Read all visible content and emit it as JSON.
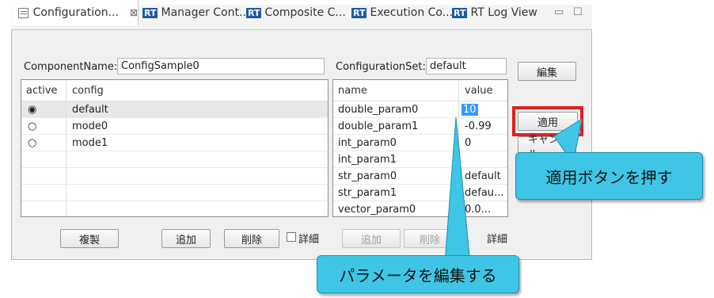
{
  "tabs": [
    {
      "label": "Configuration...",
      "active": true,
      "icon": "config-view-icon"
    },
    {
      "label": "Manager Cont...",
      "rt": "RT"
    },
    {
      "label": "Composite C...",
      "rt": "RT"
    },
    {
      "label": "Execution Co...",
      "rt": "RT"
    },
    {
      "label": "RT Log View",
      "rt": "RT"
    }
  ],
  "tab_close_glyph": "⊠",
  "window_controls": {
    "minimize": "▭",
    "maximize": "☐"
  },
  "component": {
    "label": "ComponentName:",
    "value": "ConfigSample0"
  },
  "configset": {
    "label": "ConfigurationSet:",
    "value": "default"
  },
  "config_table": {
    "headers": {
      "active": "active",
      "config": "config"
    },
    "rows": [
      {
        "name": "default",
        "active": true
      },
      {
        "name": "mode0",
        "active": false
      },
      {
        "name": "mode1",
        "active": false
      }
    ]
  },
  "param_table": {
    "headers": {
      "name": "name",
      "value": "value"
    },
    "rows": [
      {
        "name": "double_param0",
        "value": "10"
      },
      {
        "name": "double_param1",
        "value": "-0.99"
      },
      {
        "name": "int_param0",
        "value": "0"
      },
      {
        "name": "int_param1",
        "value": ""
      },
      {
        "name": "str_param0",
        "value": "default"
      },
      {
        "name": "str_param1",
        "value": "defau..."
      },
      {
        "name": "vector_param0",
        "value": "0.0..."
      }
    ]
  },
  "left_buttons": {
    "copy": "複製",
    "add": "追加",
    "delete": "削除",
    "detail": "詳細"
  },
  "right_buttons": {
    "add": "追加",
    "delete": "削除",
    "detail": "詳細"
  },
  "side_buttons": {
    "edit": "編集",
    "apply": "適用",
    "cancel": "キャンセル"
  },
  "callouts": {
    "apply": "適用ボタンを押す",
    "edit": "パラメータを編集する"
  },
  "colors": {
    "callout": "#3fc6e6",
    "highlight": "#e02020",
    "rt_badge": "#1f5aa6",
    "selection": "#3399ff"
  }
}
